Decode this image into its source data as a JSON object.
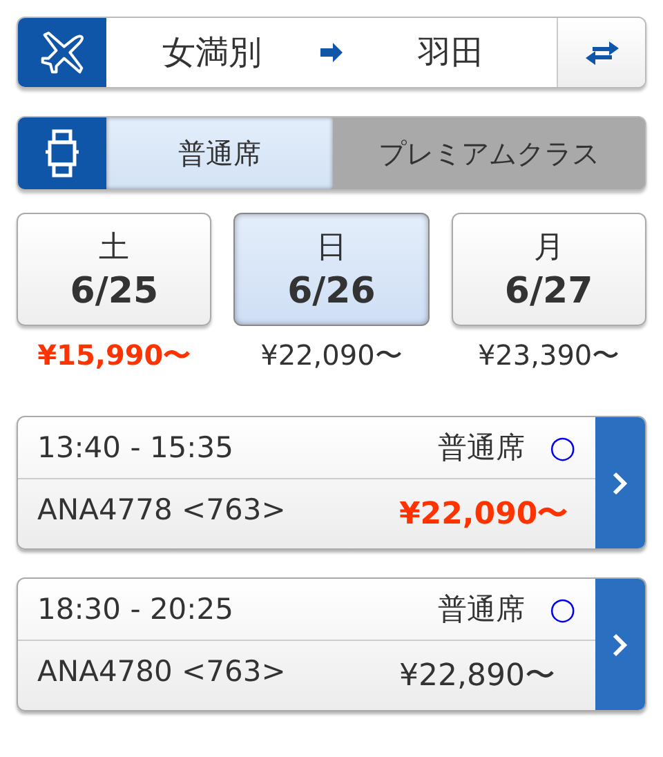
{
  "route": {
    "from": "女満別",
    "to": "羽田"
  },
  "classes": [
    {
      "label": "普通席",
      "selected": true
    },
    {
      "label": "プレミアムクラス",
      "selected": false
    }
  ],
  "dates": [
    {
      "weekday": "土",
      "date": "6/25",
      "price": "¥15,990〜",
      "selected": false,
      "cheapest": true
    },
    {
      "weekday": "日",
      "date": "6/26",
      "price": "¥22,090〜",
      "selected": true,
      "cheapest": false
    },
    {
      "weekday": "月",
      "date": "6/27",
      "price": "¥23,390〜",
      "selected": false,
      "cheapest": false
    }
  ],
  "flights": [
    {
      "time": "13:40 - 15:35",
      "seat_class": "普通席",
      "availability": "○",
      "flight": "ANA4778 <763>",
      "price": "¥22,090〜",
      "cheapest": true
    },
    {
      "time": "18:30 - 20:25",
      "seat_class": "普通席",
      "availability": "○",
      "flight": "ANA4780 <763>",
      "price": "¥22,890〜",
      "cheapest": false
    }
  ]
}
